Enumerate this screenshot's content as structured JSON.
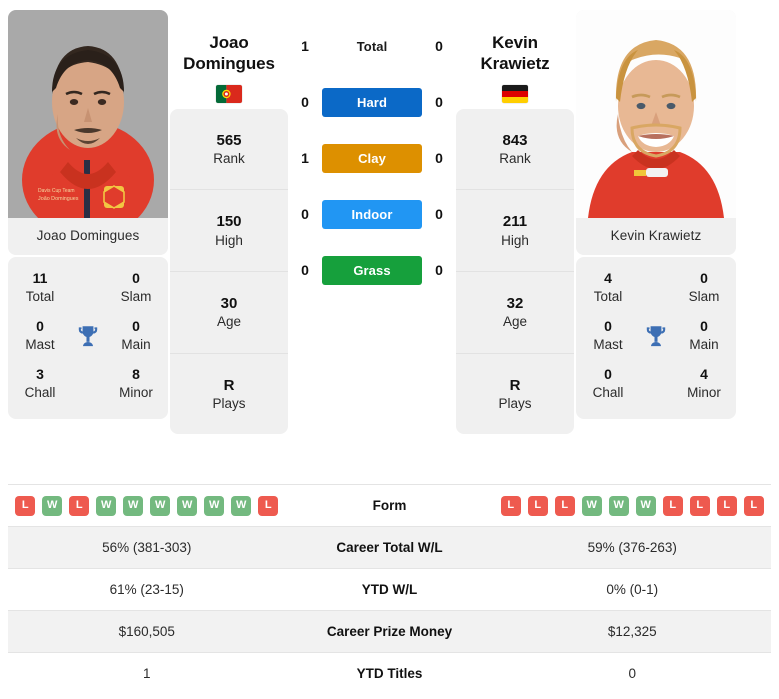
{
  "colors": {
    "hard": "#0b69c7",
    "clay": "#dd9000",
    "indoor": "#2196f3",
    "grass": "#16a03c",
    "win": "#73b97f",
    "loss": "#ee5a4f",
    "trophy": "#3d6fb4",
    "card_bg": "#f0f0f0"
  },
  "left_player": {
    "name_line1": "Joao",
    "name_line2": "Domingues",
    "full_name": "Joao Domingues",
    "country": "Portugal",
    "flag_icon": "flag-portugal",
    "photo_alt": "Joao Domingues photo",
    "info": [
      {
        "value": "565",
        "label": "Rank"
      },
      {
        "value": "150",
        "label": "High"
      },
      {
        "value": "30",
        "label": "Age"
      },
      {
        "value": "R",
        "label": "Plays"
      }
    ],
    "titles": [
      {
        "value": "11",
        "label": "Total"
      },
      {
        "value": "0",
        "label": "Slam"
      },
      {
        "value": "0",
        "label": "Mast"
      },
      {
        "value": "0",
        "label": "Main"
      },
      {
        "value": "3",
        "label": "Chall"
      },
      {
        "value": "8",
        "label": "Minor"
      }
    ],
    "surface_values": {
      "total": "1",
      "hard": "0",
      "clay": "1",
      "indoor": "0",
      "grass": "0"
    },
    "form": [
      "L",
      "W",
      "L",
      "W",
      "W",
      "W",
      "W",
      "W",
      "W",
      "L"
    ],
    "career_total_wl": "56% (381-303)",
    "ytd_wl": "61% (23-15)",
    "career_prize_money": "$160,505",
    "ytd_titles": "1"
  },
  "right_player": {
    "name_line1": "Kevin",
    "name_line2": "Krawietz",
    "full_name": "Kevin Krawietz",
    "country": "Germany",
    "flag_icon": "flag-germany",
    "photo_alt": "Kevin Krawietz photo",
    "info": [
      {
        "value": "843",
        "label": "Rank"
      },
      {
        "value": "211",
        "label": "High"
      },
      {
        "value": "32",
        "label": "Age"
      },
      {
        "value": "R",
        "label": "Plays"
      }
    ],
    "titles": [
      {
        "value": "4",
        "label": "Total"
      },
      {
        "value": "0",
        "label": "Slam"
      },
      {
        "value": "0",
        "label": "Mast"
      },
      {
        "value": "0",
        "label": "Main"
      },
      {
        "value": "0",
        "label": "Chall"
      },
      {
        "value": "4",
        "label": "Minor"
      }
    ],
    "surface_values": {
      "total": "0",
      "hard": "0",
      "clay": "0",
      "indoor": "0",
      "grass": "0"
    },
    "form": [
      "L",
      "L",
      "L",
      "W",
      "W",
      "W",
      "L",
      "L",
      "L",
      "L"
    ],
    "career_total_wl": "59% (376-263)",
    "ytd_wl": "0% (0-1)",
    "career_prize_money": "$12,325",
    "ytd_titles": "0"
  },
  "surface_rows": [
    {
      "key": "total",
      "label": "Total",
      "styled": false
    },
    {
      "key": "hard",
      "label": "Hard",
      "styled": true
    },
    {
      "key": "clay",
      "label": "Clay",
      "styled": true
    },
    {
      "key": "indoor",
      "label": "Indoor",
      "styled": true
    },
    {
      "key": "grass",
      "label": "Grass",
      "styled": true
    }
  ],
  "stats_table": {
    "rows": [
      {
        "label": "Form",
        "type": "form"
      },
      {
        "label": "Career Total W/L",
        "type": "text",
        "key": "career_total_wl"
      },
      {
        "label": "YTD W/L",
        "type": "text",
        "key": "ytd_wl"
      },
      {
        "label": "Career Prize Money",
        "type": "text",
        "key": "career_prize_money"
      },
      {
        "label": "YTD Titles",
        "type": "text",
        "key": "ytd_titles"
      }
    ]
  }
}
